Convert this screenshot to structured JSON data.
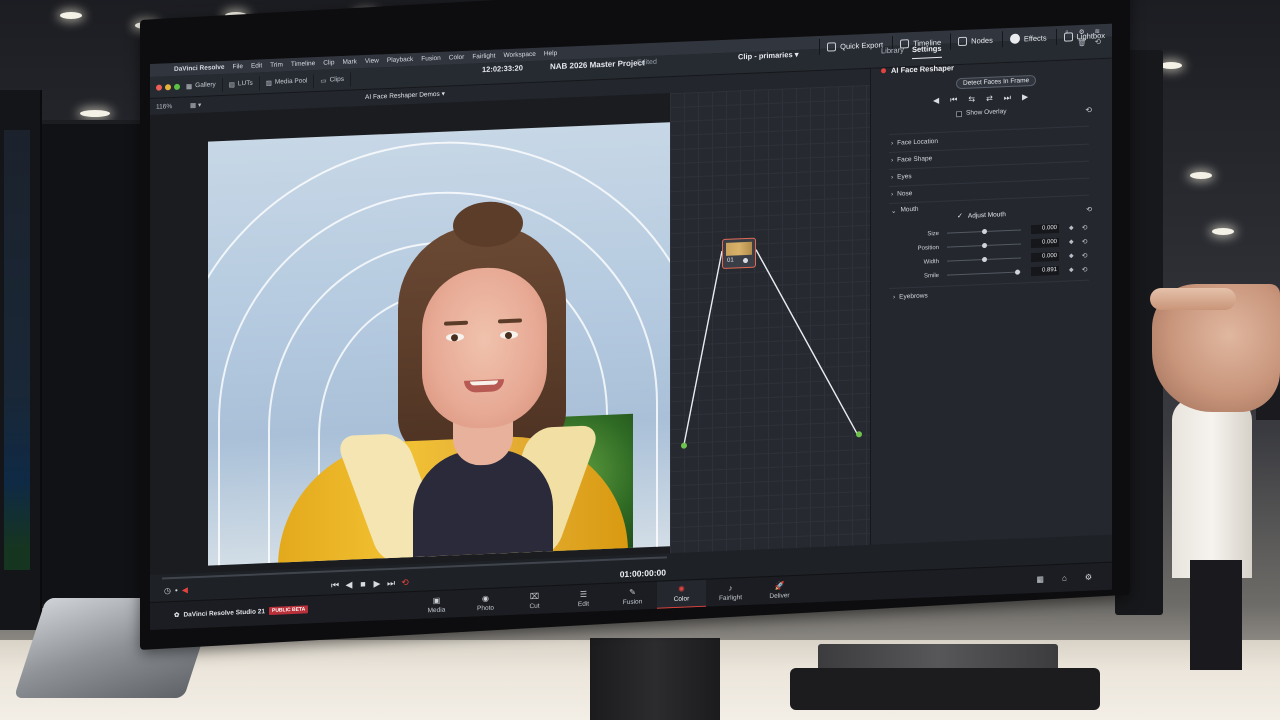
{
  "menubar": {
    "app_name": "DaVinci Resolve",
    "items": [
      "File",
      "Edit",
      "Trim",
      "Timeline",
      "Clip",
      "Mark",
      "View",
      "Playback",
      "Fusion",
      "Color",
      "Fairlight",
      "Workspace",
      "Help"
    ]
  },
  "toolbar": {
    "gallery": "Gallery",
    "luts": "LUTs",
    "media_pool": "Media Pool",
    "clips": "Clips",
    "project_title": "NAB 2026 Master Project",
    "project_status": "Edited",
    "quick_export": "Quick Export",
    "timeline": "Timeline",
    "nodes": "Nodes",
    "effects": "Effects",
    "lightbox": "Lightbox"
  },
  "viewer": {
    "zoom": "116%",
    "timeline_name": "AI Face Reshaper Demos",
    "timecode_top": "12:02:33:20",
    "timecode": "01:00:00:00"
  },
  "nodes": {
    "mode_label": "Clip",
    "mode_value": "primaries",
    "node_label": "01",
    "page_dots": 9,
    "active_dot": 0
  },
  "inspector": {
    "tabs": [
      {
        "label": "Library",
        "active": false
      },
      {
        "label": "Settings",
        "active": true
      }
    ],
    "effect_title": "AI Face Reshaper",
    "detect_button": "Detect Faces In Frame",
    "show_overlay": "Show Overlay",
    "sections": [
      "Face Location",
      "Face Shape",
      "Eyes",
      "Nose",
      "Mouth"
    ],
    "adjust_mouth": "Adjust Mouth",
    "params": [
      {
        "name": "Size",
        "value": "0.000",
        "level": 0.5
      },
      {
        "name": "Position",
        "value": "0.000",
        "level": 0.5
      },
      {
        "name": "Width",
        "value": "0.000",
        "level": 0.5
      },
      {
        "name": "Smile",
        "value": "0.891",
        "level": 0.95
      }
    ],
    "eyebrows": "Eyebrows"
  },
  "pagebar": {
    "brand": "DaVinci Resolve Studio 21",
    "beta": "PUBLIC BETA",
    "pages": [
      {
        "label": "Media",
        "icon": "media-icon",
        "glyph": "▣",
        "active": false
      },
      {
        "label": "Photo",
        "icon": "photo-icon",
        "glyph": "◉",
        "active": false
      },
      {
        "label": "Cut",
        "icon": "cut-icon",
        "glyph": "⌧",
        "active": false
      },
      {
        "label": "Edit",
        "icon": "edit-icon",
        "glyph": "☰",
        "active": false
      },
      {
        "label": "Fusion",
        "icon": "fusion-icon",
        "glyph": "✎",
        "active": false
      },
      {
        "label": "Color",
        "icon": "color-icon",
        "glyph": "✺",
        "active": true
      },
      {
        "label": "Fairlight",
        "icon": "fairlight-icon",
        "glyph": "♪",
        "active": false
      },
      {
        "label": "Deliver",
        "icon": "deliver-icon",
        "glyph": "🚀",
        "active": false
      }
    ]
  },
  "colors": {
    "accent_red": "#e2433f",
    "node_link": "#6fc24e"
  }
}
